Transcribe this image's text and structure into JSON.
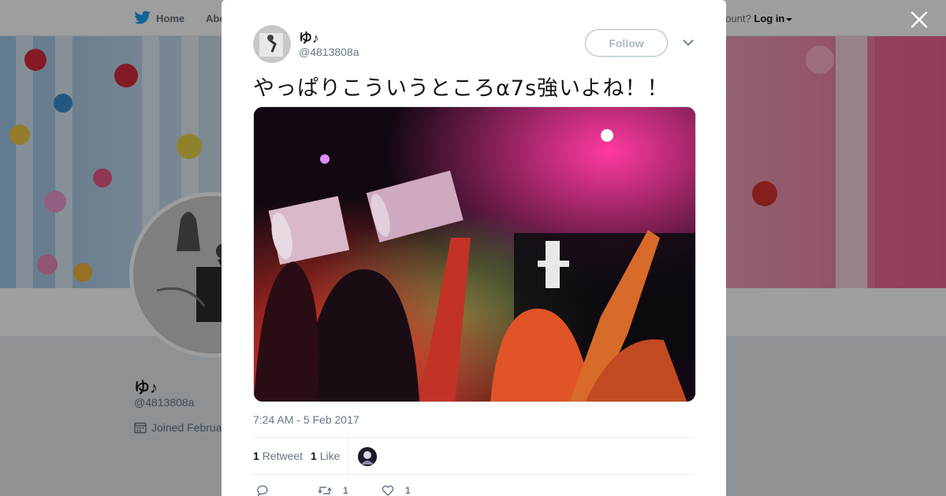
{
  "topnav": {
    "home_label": "Home",
    "about_label": "Abo",
    "account_prompt": "account?",
    "login_label": "Log in"
  },
  "profile": {
    "name": "ゆ♪",
    "handle": "@4813808a",
    "joined": "Joined Februa"
  },
  "tweet": {
    "author_name": "ゆ♪",
    "author_handle": "@4813808a",
    "follow_label": "Follow",
    "text": "やっぱりこういうところα7s強いよね！！",
    "timestamp": "7:24 AM - 5 Feb 2017",
    "retweet_count": "1",
    "retweet_label": "Retweet",
    "like_count": "1",
    "like_label": "Like",
    "action_retweet_count": "1",
    "action_like_count": "1"
  },
  "colors": {
    "link_blue": "#1da1f2",
    "text_primary": "#14171a",
    "text_secondary": "#657786",
    "follow_border": "#aab8c2"
  },
  "icons": [
    "twitter-bird-icon",
    "caret-down-icon",
    "close-icon",
    "chevron-down-icon",
    "calendar-icon",
    "reply-icon",
    "retweet-icon",
    "heart-icon"
  ]
}
